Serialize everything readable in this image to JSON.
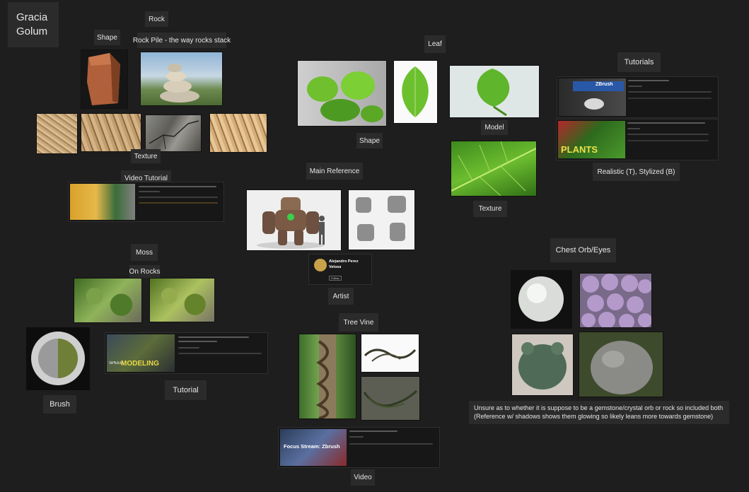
{
  "title": {
    "line1": "Gracia",
    "line2": "Golum"
  },
  "labels": {
    "rock": "Rock",
    "shape_rock": "Shape",
    "rock_pile": "Rock Pile - the way rocks stack",
    "texture_rock": "Texture",
    "video_tutorial": "Video Tutorial",
    "moss": "Moss",
    "on_rocks": "On Rocks",
    "brush": "Brush",
    "tutorial": "Tutorial",
    "leaf": "Leaf",
    "shape_leaf": "Shape",
    "model": "Model",
    "texture_leaf": "Texture",
    "tutorials": "Tutorials",
    "realistic": "Realistic (T), Stylized (B)",
    "main_reference": "Main Reference",
    "artist": "Artist",
    "tree_vine": "Tree Vine",
    "video": "Video",
    "chest_orb": "Chest Orb/Eyes"
  },
  "artist_card": {
    "name_line1": "Alejandro Perez",
    "name_line2": "Velosa",
    "follow": "Follow"
  },
  "note": {
    "line1": "Unsure as to whether it is suppose to be a gemstone/crystal orb or rock so included both",
    "line2": "(Reference w/ shadows shows them glowing so likely leans more towards gemstone)"
  },
  "thumb_text": {
    "zbrush_leaf": "ZBrush",
    "plants": "PLANTS",
    "speed": "SPEED",
    "modeling": "MODELING",
    "focus_stream": "Focus Stream: Zbrush"
  },
  "colors": {
    "background": "#1e1e1e",
    "label_bg": "#2b2b2b",
    "text": "#e6e6e6"
  }
}
